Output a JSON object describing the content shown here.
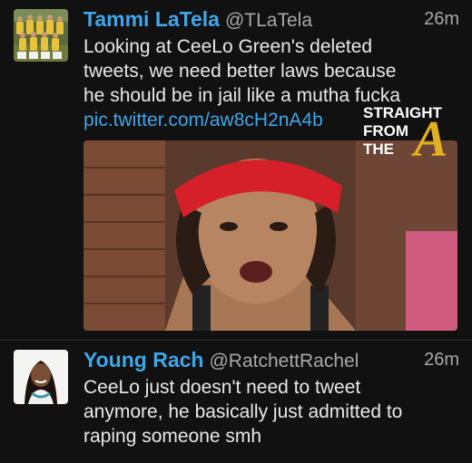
{
  "tweets": [
    {
      "name": "Tammi LaTela",
      "handle": "@TLaTela",
      "time": "26m",
      "text_lines": [
        "Looking at CeeLo Green's deleted",
        "tweets, we need better laws because",
        "he should be in jail like a mutha fucka"
      ],
      "link": "pic.twitter.com/aw8cH2nA4b",
      "avatar_icon": "team-photo-avatar",
      "media_icon": "photo-thumbnail"
    },
    {
      "name": "Young Rach",
      "handle": "@RatchettRachel",
      "time": "26m",
      "text_lines": [
        "CeeLo just doesn't need to tweet",
        "anymore, he basically just admitted to",
        "raping someone smh"
      ],
      "avatar_icon": "portrait-avatar"
    }
  ],
  "watermark": {
    "line1": "STRAIGHT",
    "line2": "FROM",
    "line3": "THE",
    "letter": "A"
  },
  "colors": {
    "background": "#111111",
    "name_link": "#3ea7ea",
    "meta": "#a8a8a8",
    "body_text": "#e8e8e8"
  }
}
